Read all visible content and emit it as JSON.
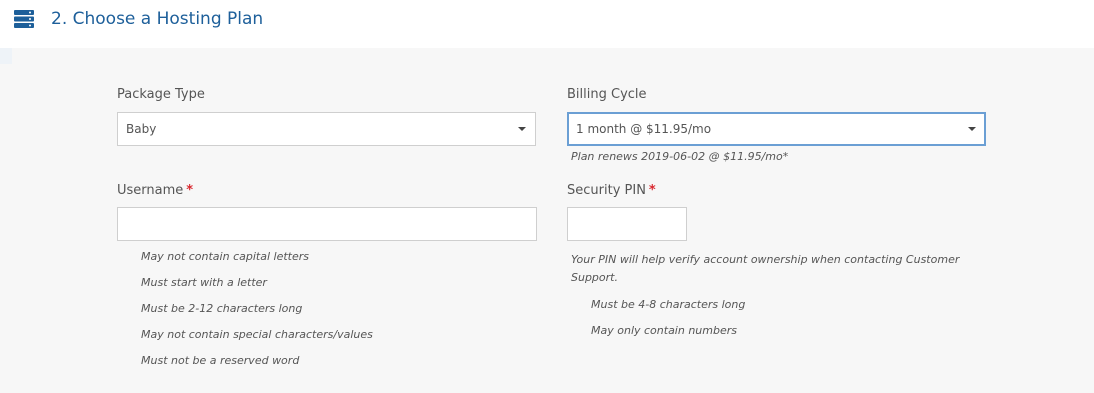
{
  "section": {
    "title": "2. Choose a Hosting Plan",
    "icon": "server-stack-icon",
    "accent_color": "#1d5f9a"
  },
  "package_type": {
    "label": "Package Type",
    "selected": "Baby"
  },
  "billing_cycle": {
    "label": "Billing Cycle",
    "selected": "1 month @ $11.95/mo",
    "renewal_note": "Plan renews 2019-06-02 @ $11.95/mo*"
  },
  "username": {
    "label": "Username",
    "required_marker": "*",
    "value": "",
    "rules": [
      "May not contain capital letters",
      "Must start with a letter",
      "Must be 2-12 characters long",
      "May not contain special characters/values",
      "Must not be a reserved word"
    ]
  },
  "security_pin": {
    "label": "Security PIN",
    "required_marker": "*",
    "value": "",
    "description": "Your PIN will help verify account ownership when contacting Customer Support.",
    "rules": [
      "Must be 4-8 characters long",
      "May only contain numbers"
    ]
  },
  "colors": {
    "required": "#d9282f",
    "focus_border": "#6b9fd4"
  }
}
